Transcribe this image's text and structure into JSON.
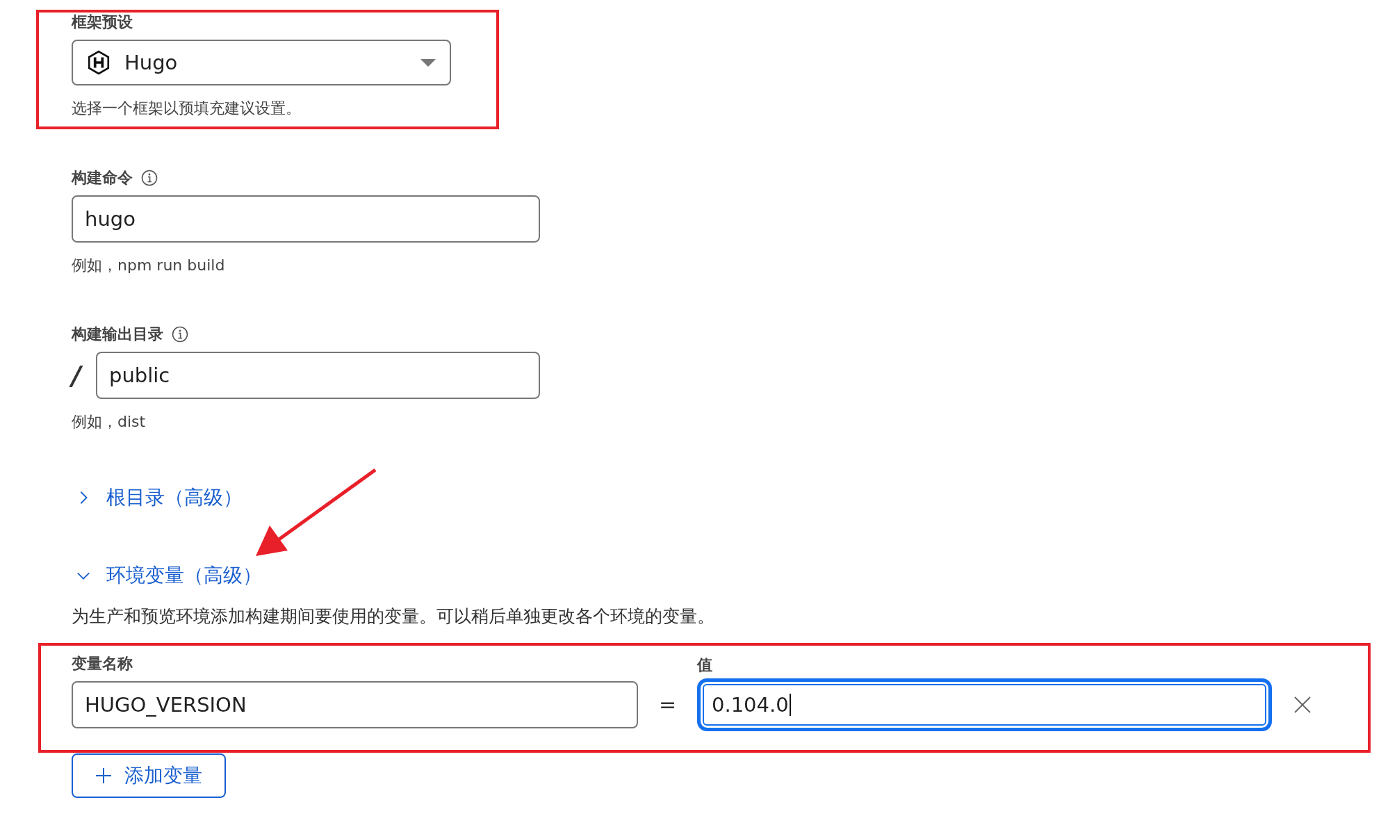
{
  "framework_preset": {
    "label": "框架预设",
    "value": "Hugo",
    "hint": "选择一个框架以预填充建议设置。"
  },
  "build_command": {
    "label": "构建命令",
    "value": "hugo",
    "hint": "例如，npm run build"
  },
  "build_output": {
    "label": "构建输出目录",
    "prefix": "/",
    "value": "public",
    "hint": "例如，dist"
  },
  "sections": [
    {
      "label": "根目录（高级）",
      "expanded": false
    },
    {
      "label": "环境变量（高级）",
      "expanded": true,
      "description": "为生产和预览环境添加构建期间要使用的变量。可以稍后单独更改各个环境的变量。",
      "variables": [
        {
          "name_label": "变量名称",
          "name": "HUGO_VERSION",
          "separator": "=",
          "value_label": "值",
          "value": "0.104.0",
          "focused": true
        }
      ],
      "add_button": "添加变量"
    }
  ]
}
